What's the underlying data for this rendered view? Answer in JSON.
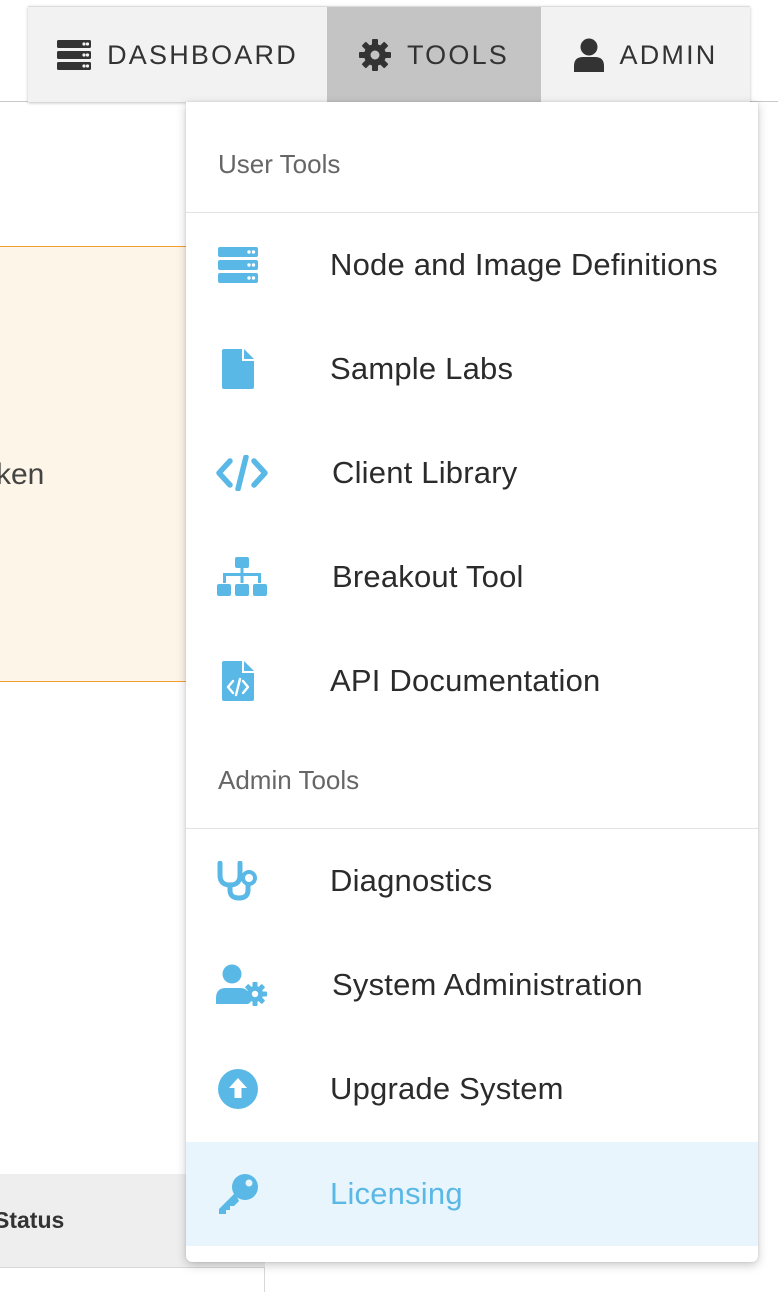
{
  "nav": {
    "dashboard_label": "DASHBOARD",
    "tools_label": "TOOLS",
    "admin_label": "ADMIN",
    "active": "TOOLS"
  },
  "background": {
    "alert_text_fragment": "ken",
    "table_header_fragment": "Status"
  },
  "dropdown": {
    "user_tools_header": "User Tools",
    "admin_tools_header": "Admin Tools",
    "user_items": [
      {
        "label": "Node and Image Definitions",
        "icon": "server-stack-icon"
      },
      {
        "label": "Sample Labs",
        "icon": "file-icon"
      },
      {
        "label": "Client Library",
        "icon": "code-icon"
      },
      {
        "label": "Breakout Tool",
        "icon": "sitemap-icon"
      },
      {
        "label": "API Documentation",
        "icon": "file-code-icon"
      }
    ],
    "admin_items": [
      {
        "label": "Diagnostics",
        "icon": "stethoscope-icon"
      },
      {
        "label": "System Administration",
        "icon": "user-cog-icon"
      },
      {
        "label": "Upgrade System",
        "icon": "arrow-circle-up-icon"
      },
      {
        "label": "Licensing",
        "icon": "key-icon",
        "active": true
      }
    ]
  },
  "colors": {
    "icon_blue": "#5ab8e6",
    "active_bg": "#e9f5fc",
    "nav_bg": "#f2f2f2",
    "nav_active_bg": "#c4c4c4",
    "alert_bg": "#fdf5e8",
    "alert_border": "#f0a030"
  }
}
